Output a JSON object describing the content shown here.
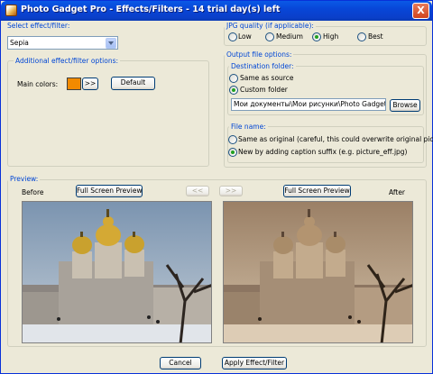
{
  "window": {
    "title": "Photo Gadget Pro - Effects/Filters - 14 trial day(s) left",
    "close": "X"
  },
  "effect": {
    "group_label": "Select effect/filter:",
    "selected": "Sepia"
  },
  "options": {
    "group_label": "Additional effect/filter options:",
    "main_colors_label": "Main colors:",
    "color_value": "#f28a00",
    "more_button": ">>",
    "default_button": "Default"
  },
  "jpg": {
    "group_label": "JPG quality (if applicable):",
    "options": [
      "Low",
      "Medium",
      "High",
      "Best"
    ],
    "selected": "High"
  },
  "output": {
    "group_label": "Output file options:",
    "destination": {
      "label": "Destination folder:",
      "same_as_source": "Same as source",
      "custom_folder": "Custom folder",
      "selected": "Custom folder",
      "path": "Мои документы\\Мои рисунки\\Photo Gadget Pro",
      "browse": "Browse"
    },
    "file_name": {
      "label": "File name:",
      "same_as_original": "Same as original (careful, this could overwrite original picture!",
      "new_caption": "New by adding caption suffix (e.g. picture_eff.jpg)",
      "selected": "New by adding caption suffix"
    }
  },
  "preview": {
    "label": "Preview:",
    "before": "Before",
    "after": "After",
    "full_screen": "Full Screen Preview",
    "prev": "<<",
    "next": ">>"
  },
  "footer": {
    "cancel": "Cancel",
    "apply": "Apply Effect/Filter"
  }
}
